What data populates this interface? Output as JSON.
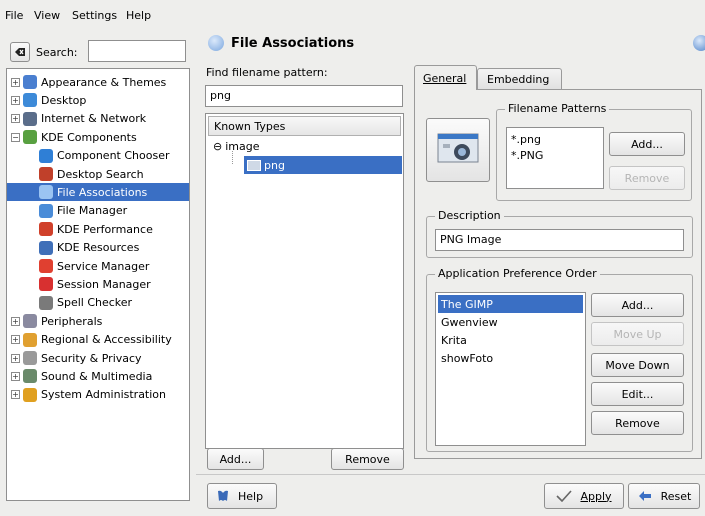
{
  "menu": {
    "file": "File",
    "view": "View",
    "settings": "Settings",
    "help": "Help"
  },
  "search": {
    "label": "Search:",
    "value": ""
  },
  "sidebar": {
    "items": [
      {
        "label": "Appearance & Themes",
        "icon": "appearance-icon",
        "level": 0,
        "expander": "+",
        "color": "#4a7fd0"
      },
      {
        "label": "Desktop",
        "icon": "desktop-icon",
        "level": 0,
        "expander": "+",
        "color": "#3d8ad8"
      },
      {
        "label": "Internet & Network",
        "icon": "network-icon",
        "level": 0,
        "expander": "+",
        "color": "#5a6d8a"
      },
      {
        "label": "KDE Components",
        "icon": "kde-components-icon",
        "level": 0,
        "expander": "−",
        "color": "#58a040"
      },
      {
        "label": "Component Chooser",
        "icon": "component-chooser-icon",
        "level": 1,
        "color": "#2f7fd6"
      },
      {
        "label": "Desktop Search",
        "icon": "desktop-search-icon",
        "level": 1,
        "color": "#c0402a"
      },
      {
        "label": "File Associations",
        "icon": "file-associations-icon",
        "level": 1,
        "color": "#9bc4f2",
        "selected": true
      },
      {
        "label": "File Manager",
        "icon": "file-manager-icon",
        "level": 1,
        "color": "#4a8cd8"
      },
      {
        "label": "KDE Performance",
        "icon": "performance-icon",
        "level": 1,
        "color": "#d0402a"
      },
      {
        "label": "KDE Resources",
        "icon": "resources-icon",
        "level": 1,
        "color": "#3f6fb8"
      },
      {
        "label": "Service Manager",
        "icon": "service-manager-icon",
        "level": 1,
        "color": "#e04030"
      },
      {
        "label": "Session Manager",
        "icon": "session-manager-icon",
        "level": 1,
        "color": "#d83030"
      },
      {
        "label": "Spell Checker",
        "icon": "spell-checker-icon",
        "level": 1,
        "color": "#7a7a7a"
      },
      {
        "label": "Peripherals",
        "icon": "peripherals-icon",
        "level": 0,
        "expander": "+",
        "color": "#8a8aa0"
      },
      {
        "label": "Regional & Accessibility",
        "icon": "regional-icon",
        "level": 0,
        "expander": "+",
        "color": "#e0a030"
      },
      {
        "label": "Security & Privacy",
        "icon": "security-icon",
        "level": 0,
        "expander": "+",
        "color": "#9a9a9a"
      },
      {
        "label": "Sound & Multimedia",
        "icon": "sound-icon",
        "level": 0,
        "expander": "+",
        "color": "#6a8a6a"
      },
      {
        "label": "System Administration",
        "icon": "system-admin-icon",
        "level": 0,
        "expander": "+",
        "color": "#e0a020"
      }
    ]
  },
  "header": {
    "title": "File Associations"
  },
  "find": {
    "label": "Find filename pattern:",
    "value": "png"
  },
  "known_types": {
    "header": "Known Types",
    "group": "image",
    "child": "png"
  },
  "left_buttons": {
    "add": "Add...",
    "remove": "Remove"
  },
  "tabs": {
    "general": "General",
    "embedding": "Embedding"
  },
  "filename_patterns": {
    "title": "Filename Patterns",
    "items": [
      "*.png",
      "*.PNG"
    ],
    "add": "Add...",
    "remove": "Remove"
  },
  "description": {
    "title": "Description",
    "value": "PNG Image"
  },
  "app_pref": {
    "title": "Application Preference Order",
    "items": [
      "The GIMP",
      "Gwenview",
      "Krita",
      "showFoto"
    ],
    "selected_index": 0,
    "add": "Add...",
    "move_up": "Move Up",
    "move_down": "Move Down",
    "edit": "Edit...",
    "remove": "Remove"
  },
  "bottom": {
    "help": "Help",
    "apply": "Apply",
    "reset": "Reset"
  },
  "colors": {
    "selection": "#3a6fc4",
    "window_bg": "#eeeeec"
  }
}
